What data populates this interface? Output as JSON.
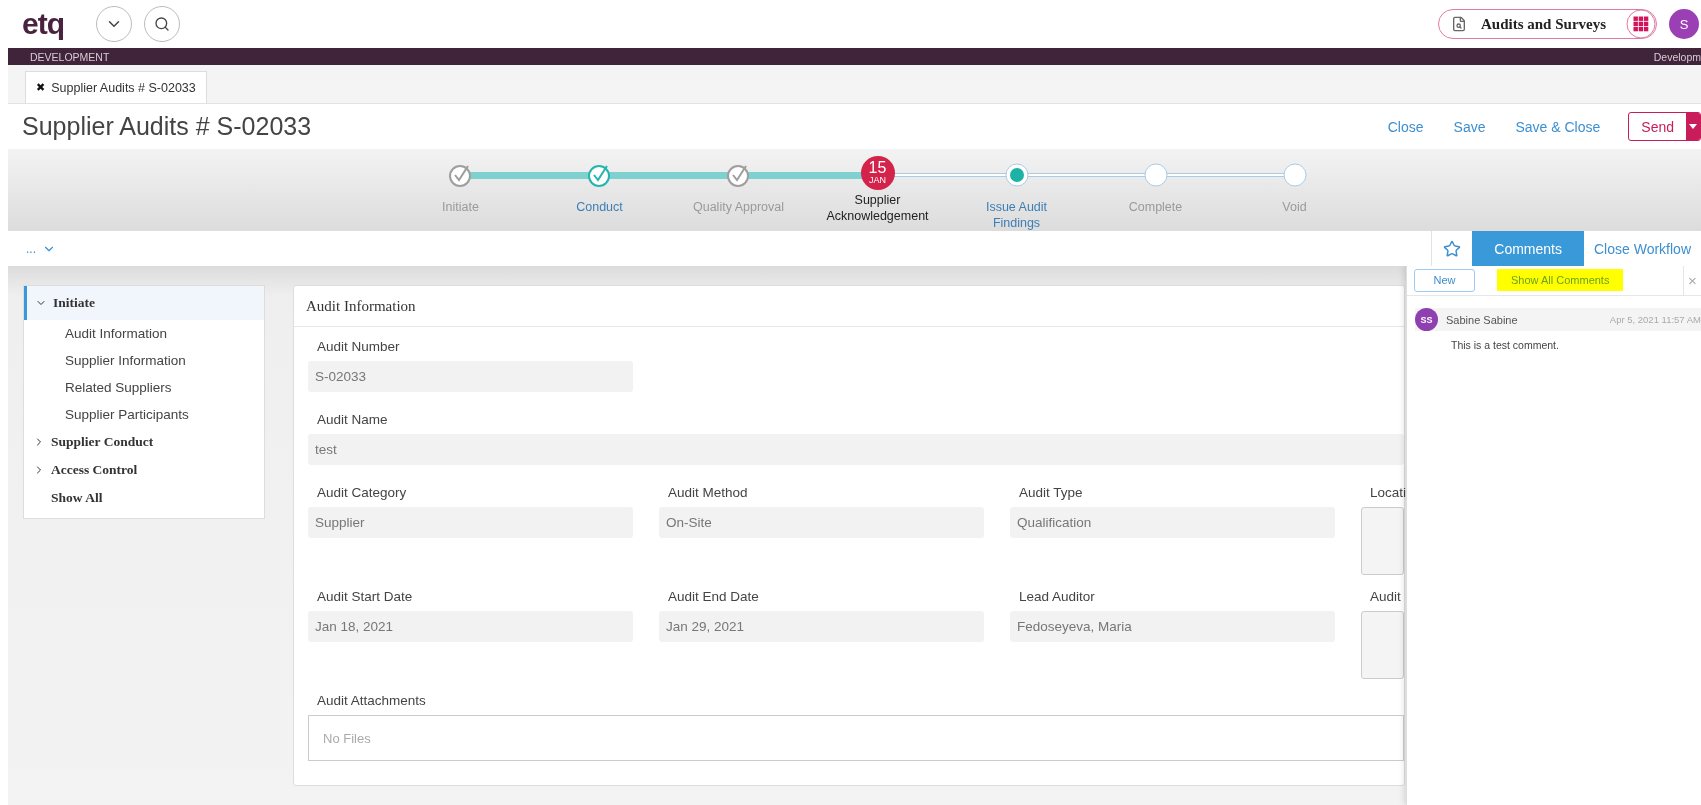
{
  "header": {
    "logo": "etq",
    "app_search": "Audits and Surveys",
    "avatar": "S"
  },
  "env_bar": {
    "left": "DEVELOPMENT",
    "right": "Developm"
  },
  "tabs": [
    {
      "label": "Supplier Audits # S-02033",
      "close": "✖",
      "selected": true
    }
  ],
  "page_title": "Supplier Audits # S-02033",
  "actions": [
    "Close",
    "Save",
    "Save & Close"
  ],
  "send_button": "Send",
  "workflow": {
    "steps": [
      {
        "label": "Initiate",
        "kind": "complete"
      },
      {
        "label": "Conduct",
        "kind": "visited"
      },
      {
        "label": "Quality Approval",
        "kind": "complete"
      },
      {
        "label": "Supplier Acknowledgement",
        "kind": "current",
        "badge_day": "15",
        "badge_month": "JAN"
      },
      {
        "label": "Issue Audit Findings",
        "kind": "next"
      },
      {
        "label": "Complete",
        "kind": "pending"
      },
      {
        "label": "Void",
        "kind": "pending"
      }
    ]
  },
  "subbar": {
    "menu": "...",
    "tabs": [
      {
        "label": "Comments",
        "selected": true
      },
      {
        "label": "Close Workflow",
        "selected": false
      }
    ]
  },
  "sidebar": {
    "sections": [
      {
        "kind": "section",
        "label": "Initiate",
        "expanded": true,
        "selected": true,
        "children": [
          {
            "label": "Audit Information"
          },
          {
            "label": "Supplier Information"
          },
          {
            "label": "Related Suppliers"
          },
          {
            "label": "Supplier Participants"
          }
        ]
      },
      {
        "kind": "section",
        "label": "Supplier Conduct",
        "expanded": false,
        "selected": false
      },
      {
        "kind": "section",
        "label": "Access Control",
        "expanded": false,
        "selected": false
      },
      {
        "kind": "link",
        "label": "Show All",
        "selected": false
      }
    ]
  },
  "form": {
    "title": "Audit Information",
    "fields": [
      {
        "kind": "text",
        "label": "Audit Number",
        "value": "S-02033"
      },
      {
        "kind": "wide",
        "label": "Audit Name",
        "value": "test"
      },
      {
        "kind": "text",
        "label": "Audit Category",
        "value": "Supplier"
      },
      {
        "kind": "text",
        "label": "Audit Method",
        "value": "On-Site"
      },
      {
        "kind": "text",
        "label": "Audit Type",
        "value": "Qualification"
      },
      {
        "kind": "area",
        "label": "Locati"
      },
      {
        "kind": "text",
        "label": "Audit Start Date",
        "value": "Jan 18, 2021"
      },
      {
        "kind": "text",
        "label": "Audit End Date",
        "value": "Jan 29, 2021"
      },
      {
        "kind": "text",
        "label": "Lead Auditor",
        "value": "Fedoseyeva, Maria"
      },
      {
        "kind": "area",
        "label": "Audit"
      }
    ],
    "attachments": {
      "label": "Audit Attachments",
      "placeholder": "No Files"
    }
  },
  "comments": {
    "new_button": "New",
    "show_all": "Show All Comments",
    "close": "×",
    "items": [
      {
        "initials": "SS",
        "author": "Sabine Sabine",
        "date": "Apr 5, 2021 11:57 AM",
        "text": "This is a test comment."
      }
    ]
  }
}
